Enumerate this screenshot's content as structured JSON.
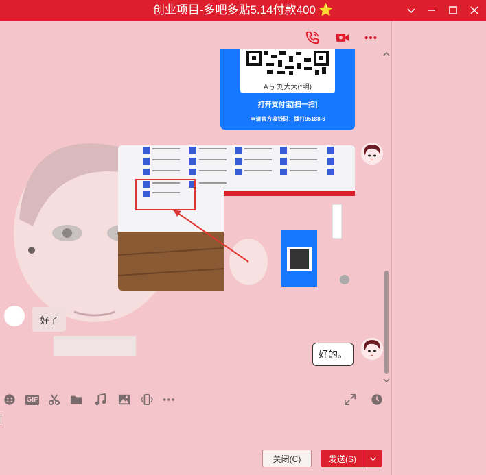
{
  "window": {
    "title": "创业项目-多吧多贴5.14付款400",
    "title_emoji": "⭐",
    "controls": [
      "chevron-down-icon",
      "minimize-icon",
      "maximize-icon",
      "close-icon"
    ]
  },
  "header_actions": [
    "phone-call-icon",
    "video-call-icon",
    "more-icon"
  ],
  "messages": {
    "alipay_card": {
      "owner": "A丂 刘大大(*明)",
      "open_text": "打开支付宝[扫一扫]",
      "apply_text": "申请官方收钱码：拨打95188-6"
    },
    "left_text": "好了",
    "right_text": "好的。"
  },
  "toolbar": {
    "items": [
      "emoji-icon",
      "gif-icon",
      "scissors-icon",
      "folder-icon",
      "music-icon",
      "image-icon",
      "shake-icon",
      "more-icon"
    ],
    "gif_label": "GIF",
    "right_items": [
      "expand-icon",
      "history-clock-icon"
    ]
  },
  "buttons": {
    "close_label": "关闭(C)",
    "send_label": "发送(S)"
  },
  "colors": {
    "titlebar": "#dc1e2d",
    "background": "#f4c6cb",
    "alipay_blue": "#1677ff"
  }
}
